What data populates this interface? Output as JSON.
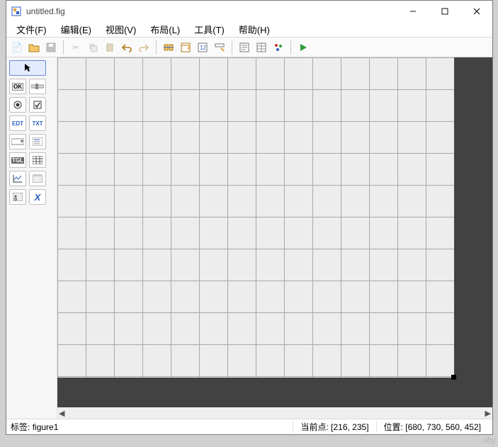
{
  "window": {
    "title": "untitled.fig"
  },
  "menu": {
    "file": "文件(F)",
    "edit": "编辑(E)",
    "view": "视图(V)",
    "layout": "布局(L)",
    "tools": "工具(T)",
    "help": "帮助(H)"
  },
  "toolbar_names": {
    "new": "new",
    "open": "open",
    "save": "save",
    "cut": "cut",
    "copy": "copy",
    "paste": "paste",
    "undo": "undo",
    "redo": "redo",
    "align": "align",
    "prop": "property-editor",
    "objbrowser": "object-browser",
    "meditor": "m-file-editor",
    "pref": "preferences",
    "toolbar-editor": "toolbar-editor",
    "tab-editor": "tab-editor",
    "run": "run"
  },
  "palette_icons": {
    "select": "↖",
    "push": "OK",
    "slider": "▭",
    "radio": "◉",
    "check": "☑",
    "edit": "EDT",
    "text": "TXT",
    "popup": "▭▾",
    "list": "▤",
    "toggle": "TGL",
    "table": "▦",
    "axes": "axes",
    "panel": "▥",
    "bgroup": "▥",
    "activex": "X"
  },
  "status": {
    "tag_label": "标签:",
    "tag_value": "figure1",
    "point_label": "当前点:",
    "point_value": "[216, 235]",
    "pos_label": "位置:",
    "pos_value": "[680, 730, 560, 452]"
  },
  "watermark": "xby",
  "colors": {
    "accent": "#2b5fc4"
  }
}
